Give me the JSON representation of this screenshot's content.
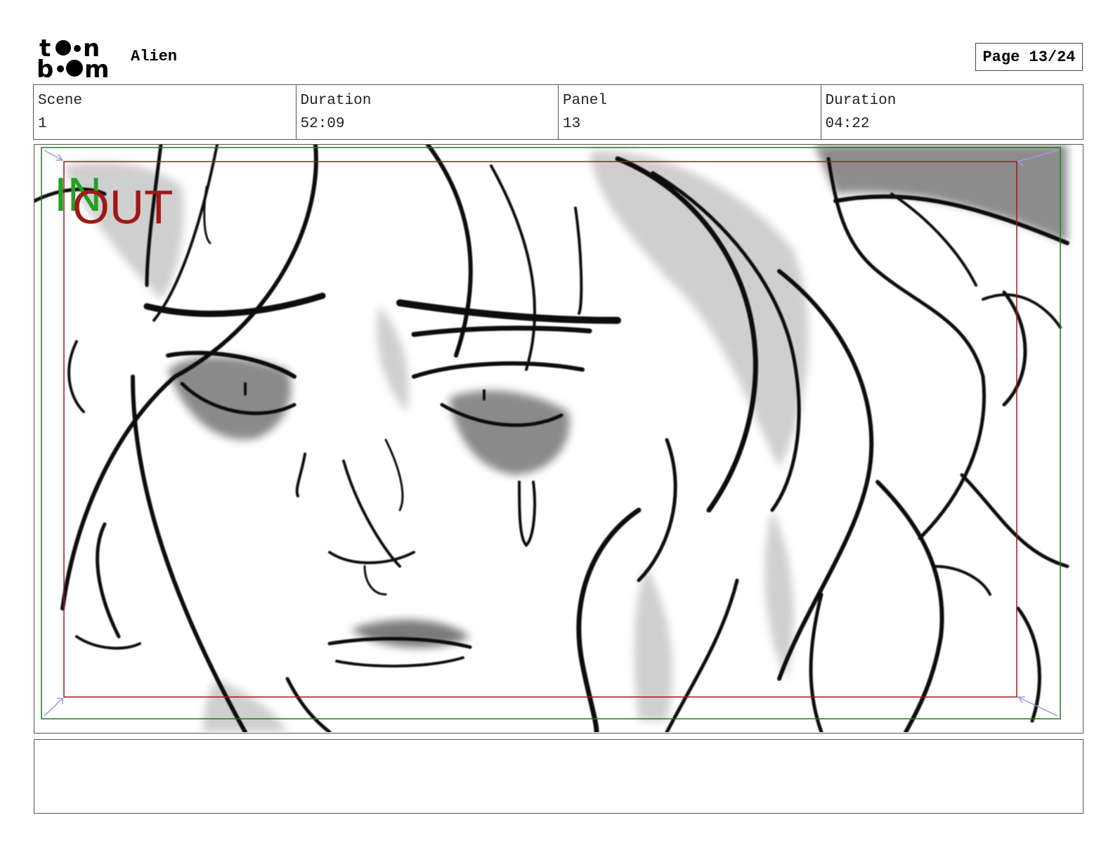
{
  "header": {
    "brand": "toon boom",
    "project_title": "Alien",
    "page_label": "Page 13/24"
  },
  "info": {
    "scene_label": "Scene",
    "scene_value": "1",
    "scene_duration_label": "Duration",
    "scene_duration_value": "52:09",
    "panel_label": "Panel",
    "panel_value": "13",
    "panel_duration_label": "Duration",
    "panel_duration_value": "04:22"
  },
  "panel": {
    "in_label": "IN",
    "out_label": "OUT",
    "colors": {
      "in_frame": "#1a7a1a",
      "in_text": "#22a022",
      "out_frame": "#a01818",
      "out_text": "#a01818",
      "arrows": "#9a9ae0"
    }
  },
  "notes": {
    "text": ""
  }
}
